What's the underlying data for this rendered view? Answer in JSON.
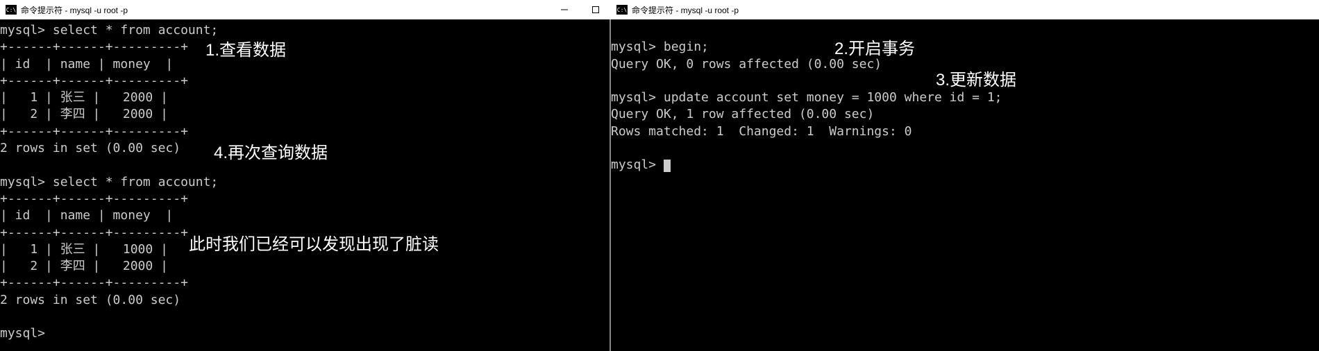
{
  "left_window": {
    "title": "命令提示符 - mysql  -u root -p",
    "controls": {
      "minimize": "−",
      "maximize": "□",
      "close": "✕"
    },
    "lines": {
      "prompt1": "mysql> select * from account;",
      "border_top1": "+------+------+---------+",
      "header1": "| id  | name | money  |",
      "border_mid1": "+------+------+---------+",
      "row1a": "|   1 | 张三 |   2000 |",
      "row1b": "|   2 | 李四 |   2000 |",
      "border_bot1": "+------+------+---------+",
      "result1": "2 rows in set (0.00 sec)",
      "blank1": "",
      "prompt2": "mysql> select * from account;",
      "border_top2": "+------+------+---------+",
      "header2": "| id  | name | money  |",
      "border_mid2": "+------+------+---------+",
      "row2a": "|   1 | 张三 |   1000 |",
      "row2b": "|   2 | 李四 |   2000 |",
      "border_bot2": "+------+------+---------+",
      "result2": "2 rows in set (0.00 sec)",
      "blank2": "",
      "prompt3": "mysql> "
    }
  },
  "right_window": {
    "title": "命令提示符 - mysql  -u root -p",
    "lines": {
      "blank0": "",
      "prompt1": "mysql> begin;",
      "result1": "Query OK, 0 rows affected (0.00 sec)",
      "blank1": "",
      "prompt2": "mysql> update account set money = 1000 where id = 1;",
      "result2a": "Query OK, 1 row affected (0.00 sec)",
      "result2b": "Rows matched: 1  Changed: 1  Warnings: 0",
      "blank2": "",
      "prompt3": "mysql> "
    }
  },
  "annotations": {
    "a1": "1.查看数据",
    "a2": "2.开启事务",
    "a3": "3.更新数据",
    "a4": "4.再次查询数据",
    "a5": "此时我们已经可以发现出现了脏读"
  }
}
